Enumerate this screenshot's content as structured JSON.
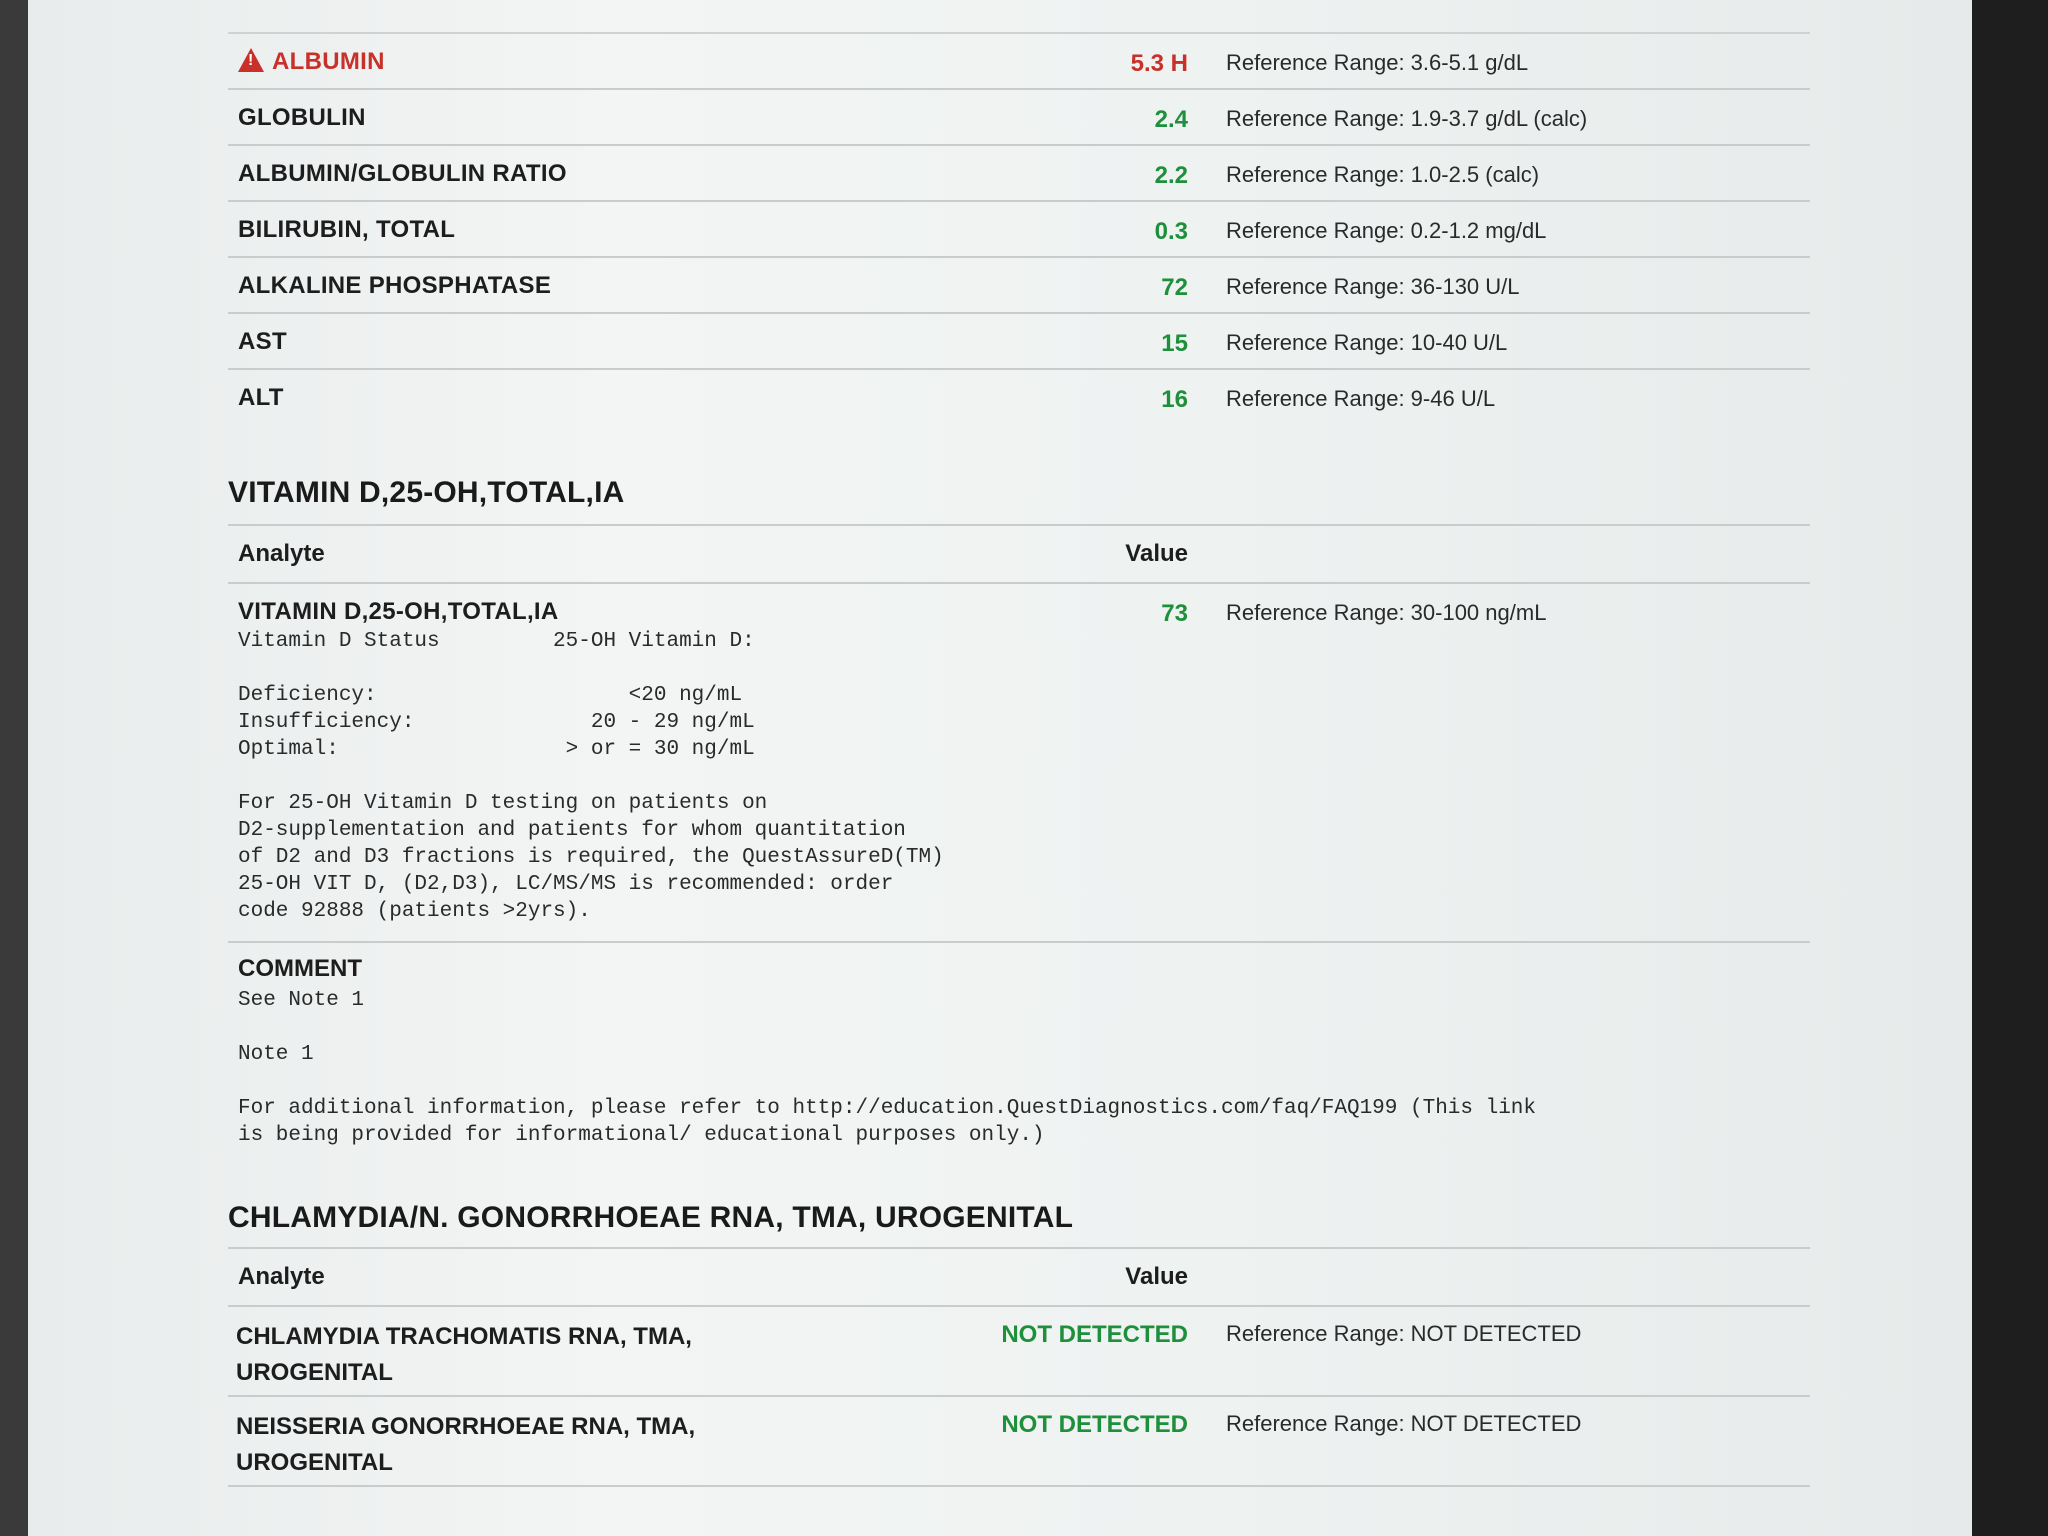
{
  "hepatic_rows": [
    {
      "name": "ALBUMIN",
      "value": "5.3 H",
      "range": "Reference Range: 3.6-5.1 g/dL",
      "flag": true
    },
    {
      "name": "GLOBULIN",
      "value": "2.4",
      "range": "Reference Range: 1.9-3.7 g/dL (calc)",
      "flag": false
    },
    {
      "name": "ALBUMIN/GLOBULIN RATIO",
      "value": "2.2",
      "range": "Reference Range: 1.0-2.5 (calc)",
      "flag": false
    },
    {
      "name": "BILIRUBIN, TOTAL",
      "value": "0.3",
      "range": "Reference Range: 0.2-1.2 mg/dL",
      "flag": false
    },
    {
      "name": "ALKALINE PHOSPHATASE",
      "value": "72",
      "range": "Reference Range: 36-130 U/L",
      "flag": false
    },
    {
      "name": "AST",
      "value": "15",
      "range": "Reference Range: 10-40 U/L",
      "flag": false
    },
    {
      "name": "ALT",
      "value": "16",
      "range": "Reference Range: 9-46 U/L",
      "flag": false
    }
  ],
  "vitd": {
    "title": "VITAMIN D,25-OH,TOTAL,IA",
    "header_analyte": "Analyte",
    "header_value": "Value",
    "row": {
      "name": "VITAMIN D,25-OH,TOTAL,IA",
      "value": "73",
      "range": "Reference Range: 30-100 ng/mL"
    },
    "notes": "Vitamin D Status         25-OH Vitamin D:\n\nDeficiency:                    <20 ng/mL\nInsufficiency:              20 - 29 ng/mL\nOptimal:                  > or = 30 ng/mL\n\nFor 25-OH Vitamin D testing on patients on\nD2-supplementation and patients for whom quantitation\nof D2 and D3 fractions is required, the QuestAssureD(TM)\n25-OH VIT D, (D2,D3), LC/MS/MS is recommended: order\ncode 92888 (patients >2yrs).",
    "comment_label": "COMMENT",
    "comment_text": "See Note 1\n\nNote 1\n\nFor additional information, please refer to http://education.QuestDiagnostics.com/faq/FAQ199 (This link\nis being provided for informational/ educational purposes only.)"
  },
  "chlamydia": {
    "title": "CHLAMYDIA/N. GONORRHOEAE RNA, TMA, UROGENITAL",
    "header_analyte": "Analyte",
    "header_value": "Value",
    "rows": [
      {
        "name": "CHLAMYDIA TRACHOMATIS RNA, TMA, UROGENITAL",
        "value": "NOT DETECTED",
        "range": "Reference Range: NOT DETECTED"
      },
      {
        "name": "NEISSERIA GONORRHOEAE RNA, TMA, UROGENITAL",
        "value": "NOT DETECTED",
        "range": "Reference Range: NOT DETECTED"
      }
    ]
  },
  "colors": {
    "normal_value": "#1e8f3a",
    "flag": "#c8302a"
  },
  "icons": {
    "flag_icon": "warning-triangle-icon"
  }
}
